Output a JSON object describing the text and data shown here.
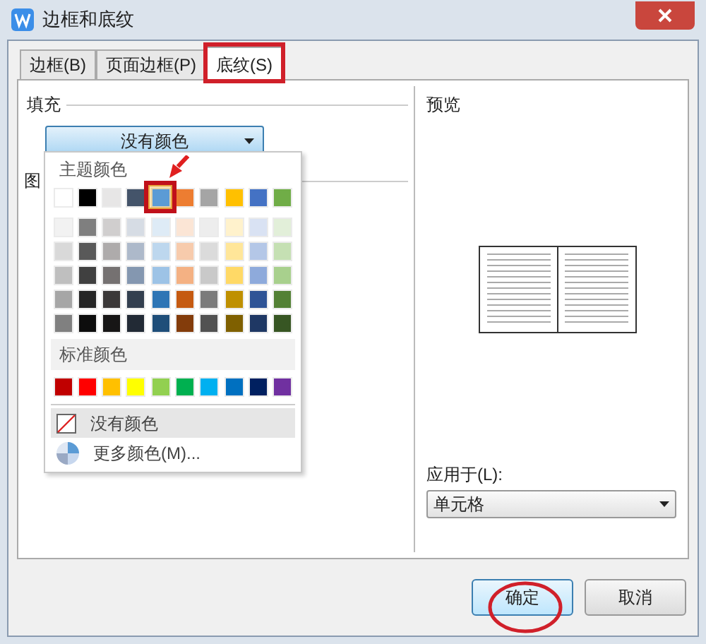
{
  "window": {
    "title": "边框和底纹"
  },
  "tabs": [
    {
      "label": "边框(B)",
      "selected": false
    },
    {
      "label": "页面边框(P)",
      "selected": false
    },
    {
      "label": "底纹(S)",
      "selected": true
    }
  ],
  "fill": {
    "label": "填充",
    "dropdown_value": "没有颜色",
    "pattern_label": "图"
  },
  "color_menu": {
    "theme_heading": "主题颜色",
    "theme_colors": [
      {
        "color": "#ffffff",
        "selected": false
      },
      {
        "color": "#000000",
        "selected": false
      },
      {
        "color": "#e7e6e6",
        "selected": false
      },
      {
        "color": "#44546a",
        "selected": false
      },
      {
        "color": "#5b9bd5",
        "selected": true
      },
      {
        "color": "#ed7d31",
        "selected": false
      },
      {
        "color": "#a5a5a5",
        "selected": false
      },
      {
        "color": "#ffc000",
        "selected": false
      },
      {
        "color": "#4472c4",
        "selected": false
      },
      {
        "color": "#70ad47",
        "selected": false
      }
    ],
    "shade_rows": [
      {
        "swatches": [
          {
            "color": "#f2f2f2"
          },
          {
            "color": "#7f7f7f"
          },
          {
            "color": "#d0cece"
          },
          {
            "color": "#d6dce4"
          },
          {
            "color": "#deebf6"
          },
          {
            "color": "#fbe5d5"
          },
          {
            "color": "#ededed"
          },
          {
            "color": "#fff2cc"
          },
          {
            "color": "#d9e2f3"
          },
          {
            "color": "#e2efd9"
          }
        ]
      },
      {
        "swatches": [
          {
            "color": "#d9d9d9"
          },
          {
            "color": "#595959"
          },
          {
            "color": "#aeabab"
          },
          {
            "color": "#adb9ca"
          },
          {
            "color": "#bdd7ee"
          },
          {
            "color": "#f7cbac"
          },
          {
            "color": "#dbdbdb"
          },
          {
            "color": "#ffe699"
          },
          {
            "color": "#b4c7e7"
          },
          {
            "color": "#c5e0b3"
          }
        ]
      },
      {
        "swatches": [
          {
            "color": "#bfbfbf"
          },
          {
            "color": "#404040"
          },
          {
            "color": "#757171"
          },
          {
            "color": "#8497b0"
          },
          {
            "color": "#9dc3e6"
          },
          {
            "color": "#f4b183"
          },
          {
            "color": "#c9c9c9"
          },
          {
            "color": "#ffd966"
          },
          {
            "color": "#8eaadb"
          },
          {
            "color": "#a8d08d"
          }
        ]
      },
      {
        "swatches": [
          {
            "color": "#a6a6a6"
          },
          {
            "color": "#262626"
          },
          {
            "color": "#3b3838"
          },
          {
            "color": "#333f4f"
          },
          {
            "color": "#2e75b5"
          },
          {
            "color": "#c55a11"
          },
          {
            "color": "#7b7b7b"
          },
          {
            "color": "#bf9000"
          },
          {
            "color": "#2f5496"
          },
          {
            "color": "#538135"
          }
        ]
      },
      {
        "swatches": [
          {
            "color": "#808080"
          },
          {
            "color": "#0d0d0d"
          },
          {
            "color": "#171616"
          },
          {
            "color": "#222a35"
          },
          {
            "color": "#1f4e79"
          },
          {
            "color": "#833c0b"
          },
          {
            "color": "#525252"
          },
          {
            "color": "#7f6000"
          },
          {
            "color": "#1f3864"
          },
          {
            "color": "#375623"
          }
        ]
      }
    ],
    "standard_heading": "标准颜色",
    "standard_colors": [
      {
        "color": "#c00000"
      },
      {
        "color": "#ff0000"
      },
      {
        "color": "#ffc000"
      },
      {
        "color": "#ffff00"
      },
      {
        "color": "#92d050"
      },
      {
        "color": "#00b050"
      },
      {
        "color": "#00b0f0"
      },
      {
        "color": "#0070c0"
      },
      {
        "color": "#002060"
      },
      {
        "color": "#7030a0"
      }
    ],
    "items": [
      {
        "kind": "none",
        "label": "没有颜色",
        "selected": true
      },
      {
        "kind": "more",
        "label": "更多颜色(M)...",
        "selected": false
      }
    ]
  },
  "preview": {
    "label": "预览"
  },
  "apply_to": {
    "label": "应用于(L):",
    "value": "单元格"
  },
  "buttons": [
    {
      "label": "确定",
      "kind": "primary"
    },
    {
      "label": "取消",
      "kind": "secondary"
    }
  ]
}
